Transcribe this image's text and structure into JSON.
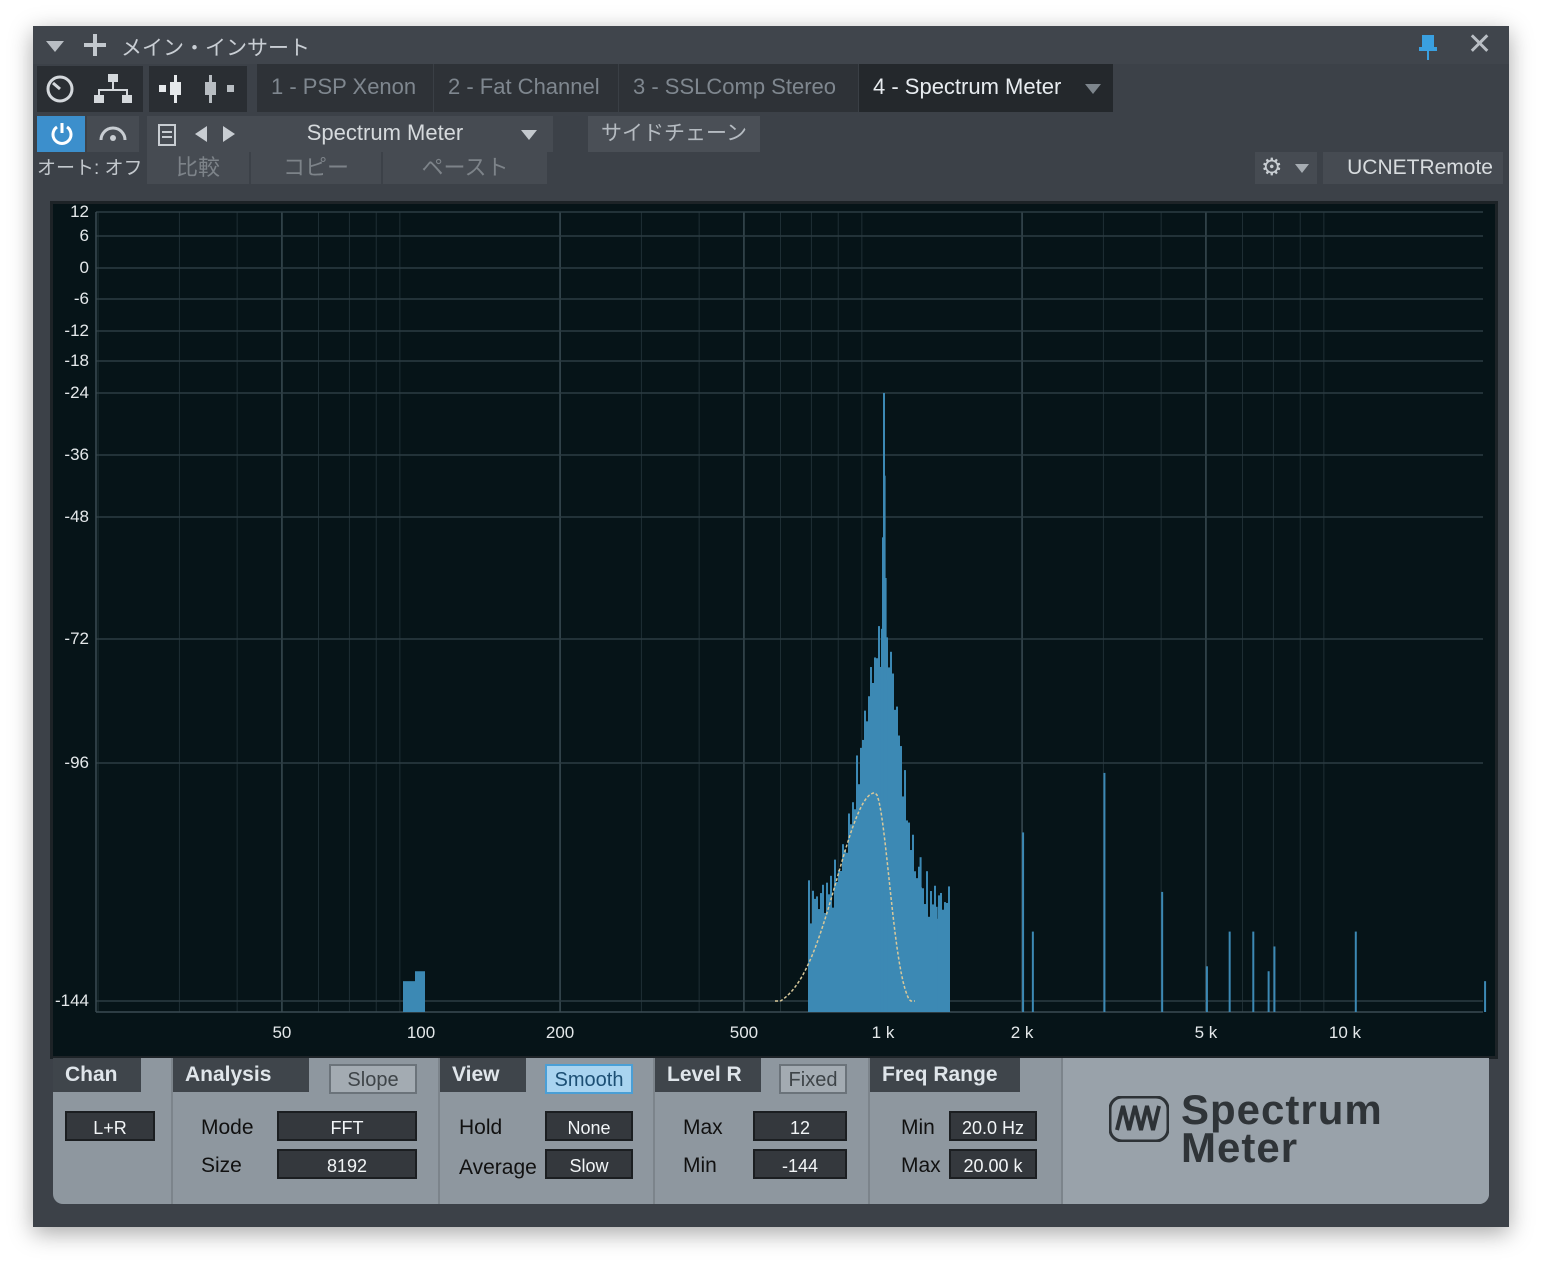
{
  "title_bar": {
    "title": "メイン・インサート",
    "add_icon": "plus-icon",
    "menu_icon": "triangle-down-icon",
    "pin_icon": "pin-icon",
    "close_icon": "close-icon"
  },
  "toolbar": {
    "icons": [
      "gauge-icon",
      "routing-icon",
      "channel-left-icon",
      "channel-right-icon"
    ],
    "tabs": [
      {
        "label": "1 - PSP Xenon"
      },
      {
        "label": "2 - Fat Channel"
      },
      {
        "label": "3 - SSLComp Stereo"
      },
      {
        "label": "4 - Spectrum Meter"
      }
    ]
  },
  "preset_bar": {
    "preset_name": "Spectrum Meter",
    "sidechain_label": "サイドチェーン",
    "auto_label": "オート: オフ",
    "compare_label": "比較",
    "copy_label": "コピー",
    "paste_label": "ペースト",
    "remote_label": "UCNETRemote"
  },
  "spectrum": {
    "y_labels": [
      "12",
      "6",
      "0",
      "-6",
      "-12",
      "-18",
      "-24",
      "-36",
      "-48",
      "-72",
      "-96",
      "-144"
    ],
    "x_labels": [
      "50",
      "100",
      "200",
      "500",
      "1 k",
      "2 k",
      "5 k",
      "10 k"
    ],
    "colors": {
      "bars": "#3c89b4",
      "curve": "#d8c89a",
      "background": "#061418",
      "grid": "#2c3c42"
    }
  },
  "panel": {
    "chan": {
      "header": "Chan",
      "value": "L+R"
    },
    "analysis": {
      "header": "Analysis",
      "slope_label": "Slope",
      "mode_label": "Mode",
      "mode_value": "FFT",
      "size_label": "Size",
      "size_value": "8192"
    },
    "view": {
      "header": "View",
      "smooth_label": "Smooth",
      "hold_label": "Hold",
      "hold_value": "None",
      "average_label": "Average",
      "average_value": "Slow"
    },
    "level": {
      "header": "Level R",
      "fixed_label": "Fixed",
      "max_label": "Max",
      "max_value": "12",
      "min_label": "Min",
      "min_value": "-144"
    },
    "freq": {
      "header": "Freq Range",
      "min_label": "Min",
      "min_value": "20.0 Hz",
      "max_label": "Max",
      "max_value": "20.00 k"
    },
    "logo": {
      "line1": "Spectrum",
      "line2": "Meter"
    }
  }
}
